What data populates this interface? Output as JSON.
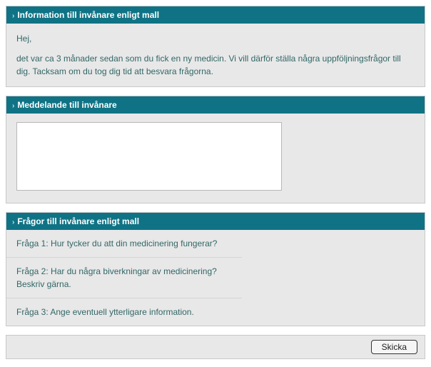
{
  "info_panel": {
    "title": "Information till invånare enligt mall",
    "greeting": "Hej,",
    "body": "det var ca 3 månader sedan som du fick en ny medicin. Vi vill därför ställa några uppföljningsfrågor till dig. Tacksam om du tog dig tid att besvara frågorna."
  },
  "message_panel": {
    "title": "Meddelande till invånare",
    "value": ""
  },
  "questions_panel": {
    "title": "Frågor till invånare enligt mall",
    "items": [
      "Fråga 1: Hur tycker du att din medicinering fungerar?",
      "Fråga 2: Har du några biverkningar av medicinering? Beskriv gärna.",
      "Fråga 3: Ange eventuell ytterligare information."
    ]
  },
  "footer": {
    "submit_label": "Skicka"
  }
}
